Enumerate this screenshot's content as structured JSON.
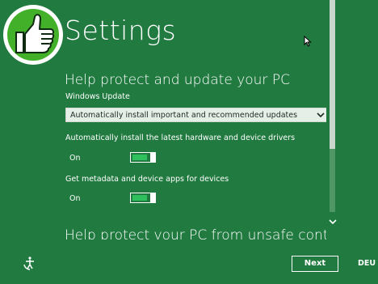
{
  "header": {
    "title": "Settings",
    "badge_icon": "thumbs-up-icon",
    "badge_color": "#43b02a"
  },
  "sections": {
    "protect_update": {
      "heading": "Help protect and update your PC",
      "windows_update_label": "Windows Update",
      "windows_update_value": "Automatically install important and recommended updates",
      "drivers_label": "Automatically install the latest hardware and device drivers",
      "drivers_state": "On",
      "metadata_label": "Get metadata and device apps for devices",
      "metadata_state": "On"
    },
    "unsafe_content": {
      "heading": "Help protect your PC from unsafe content"
    }
  },
  "footer": {
    "next_label": "Next",
    "language": "DEU",
    "accessibility_icon": "ease-of-access-icon"
  },
  "colors": {
    "background": "#217a40",
    "toggle_fill": "#2fbf5c",
    "dropdown_bg": "#e6eee8"
  }
}
